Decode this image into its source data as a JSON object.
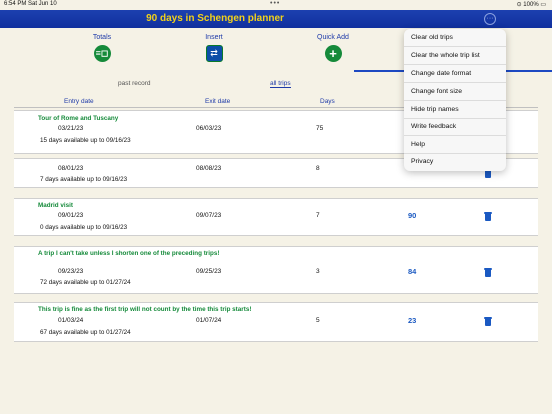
{
  "status": {
    "time": "6:54 PM   Sat Jun 10",
    "dots": "•••",
    "battery": "⊙ 100% ▭"
  },
  "app": {
    "title": "90 days in Schengen planner",
    "more_glyph": "···"
  },
  "toolbar": [
    {
      "label": "Totals",
      "icon": "totals-icon",
      "glyph": "≡◻"
    },
    {
      "label": "Insert",
      "icon": "insert-icon",
      "glyph": "⇄"
    },
    {
      "label": "Quick Add",
      "icon": "plus-icon",
      "glyph": "+"
    }
  ],
  "subtabs": {
    "past": "past record",
    "all": "all trips"
  },
  "columns": {
    "entry": "Entry date",
    "exit": "Exit date",
    "days": "Days"
  },
  "trips": [
    {
      "name": "Tour of Rome and Tuscany",
      "entry": "03/21/23",
      "exit": "06/03/23",
      "days": "75",
      "available": "15 days available up to  09/16/23",
      "remaining": ""
    },
    {
      "name": "",
      "entry": "08/01/23",
      "exit": "08/08/23",
      "days": "8",
      "available": "7 days available up to  09/16/23",
      "remaining": ""
    },
    {
      "name": "Madrid visit",
      "entry": "09/01/23",
      "exit": "09/07/23",
      "days": "7",
      "available": "0 days available up to  09/16/23",
      "remaining": "90"
    },
    {
      "name": "A trip I can't take unless I shorten one of the preceding trips!",
      "entry": "09/23/23",
      "exit": "09/25/23",
      "days": "3",
      "available": "72 days available up to  01/27/24",
      "remaining": "84"
    },
    {
      "name": "This trip is fine as the first trip will not count by the time this trip starts!",
      "entry": "01/03/24",
      "exit": "01/07/24",
      "days": "5",
      "available": "67 days available up to  01/27/24",
      "remaining": "23"
    }
  ],
  "menu": [
    "Clear old trips",
    "Clear the whole trip list",
    "Change date format",
    "Change font size",
    "Hide trip names",
    "Write feedback",
    "Help",
    "Privacy"
  ],
  "colors": {
    "accent": "#1e3aa8",
    "title_bar": "#10309e",
    "title_text": "#f2d21a",
    "trip_name": "#158a3a",
    "remaining": "#1a59c2"
  }
}
